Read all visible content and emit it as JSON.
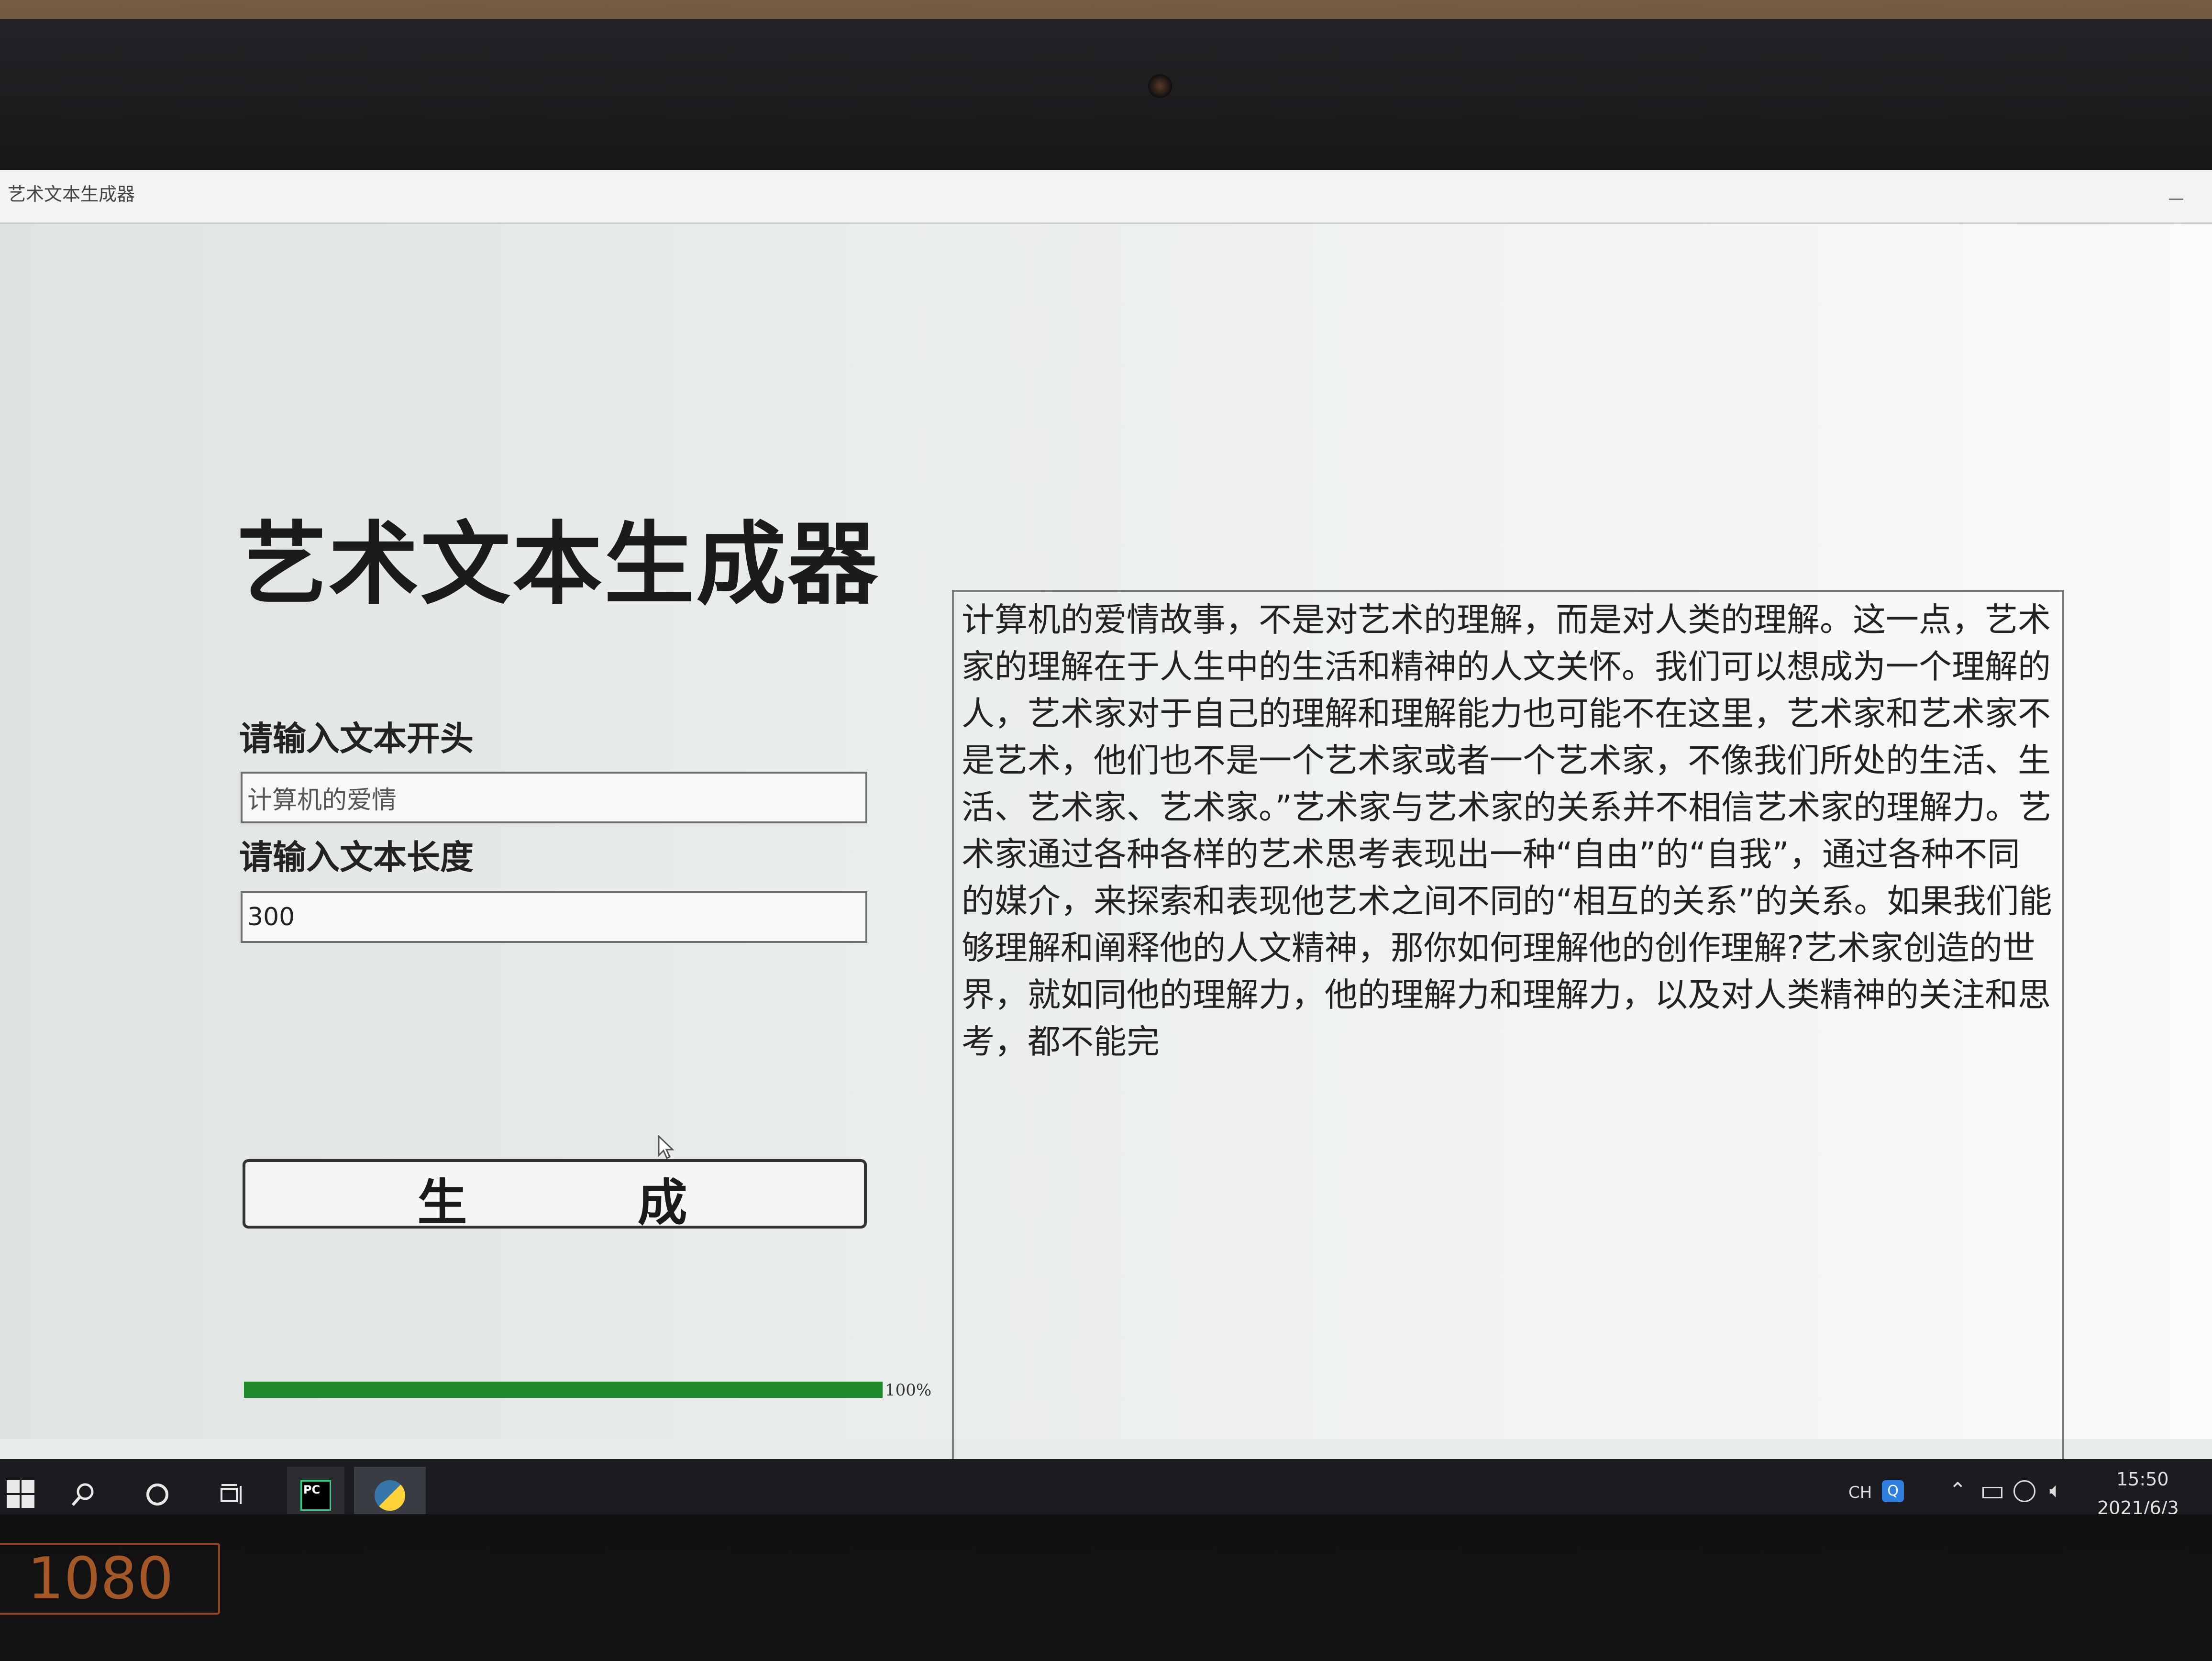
{
  "window": {
    "title": "艺术文本生成器"
  },
  "app": {
    "heading": "艺术文本生成器",
    "start_label": "请输入文本开头",
    "start_value": "计算机的爱情",
    "length_label": "请输入文本长度",
    "length_value": "300",
    "generate_label": "生 成",
    "progress_percent": 100,
    "progress_text": "100%",
    "output_text": "计算机的爱情故事，不是对艺术的理解，而是对人类的理解。这一点，艺术家的理解在于人生中的生活和精神的人文关怀。我们可以想成为一个理解的人，艺术家对于自己的理解和理解能力也可能不在这里，艺术家和艺术家不是艺术，他们也不是一个艺术家或者一个艺术家，不像我们所处的生活、生活、艺术家、艺术家。”艺术家与艺术家的关系并不相信艺术家的理解力。艺术家通过各种各样的艺术思考表现出一种“自由”的“自我”，通过各种不同的媒介，来探索和表现他艺术之间不同的“相互的关系”的关系。如果我们能够理解和阐释他的人文精神，那你如何理解他的创作理解?艺术家创造的世界，就如同他的理解力，他的理解力和理解力，以及对人类精神的关注和思考，都不能完"
  },
  "taskbar": {
    "pycharm_label": "PC",
    "ime_label": "CH",
    "ime_icon_label": "Q",
    "time": "15:50",
    "date": "2021/6/3"
  },
  "device": {
    "resolution_label": "1080"
  },
  "colors": {
    "progress": "#1f8a2a",
    "taskbar": "#1b1c20",
    "accent": "#3d7fd6"
  }
}
